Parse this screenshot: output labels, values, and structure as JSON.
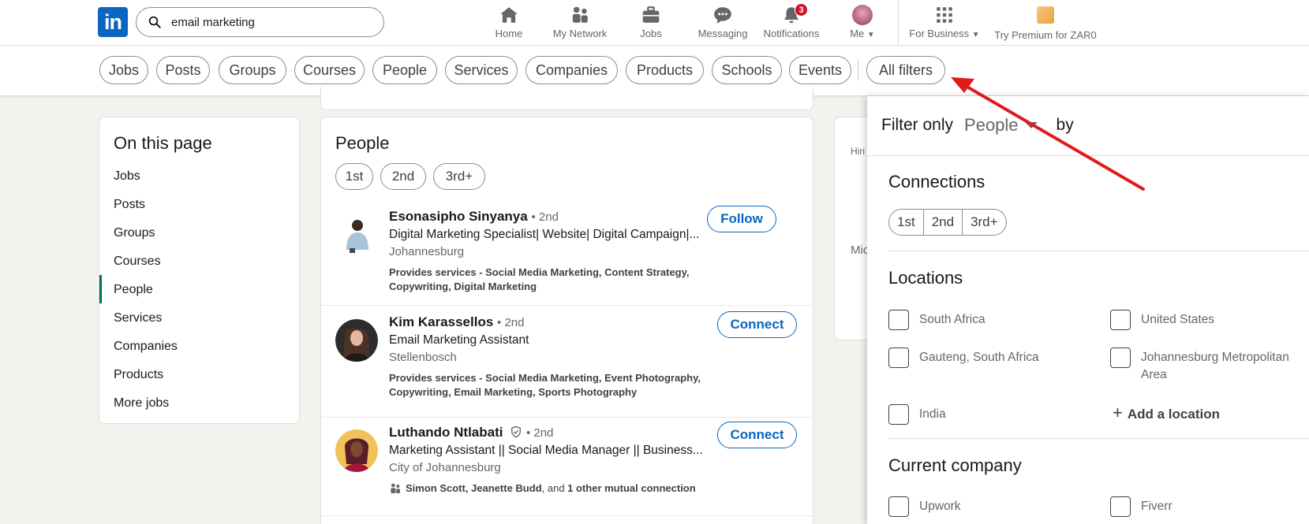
{
  "header": {
    "logo_text": "in",
    "search_value": "email marketing",
    "nav": [
      {
        "label": "Home"
      },
      {
        "label": "My Network"
      },
      {
        "label": "Jobs"
      },
      {
        "label": "Messaging"
      },
      {
        "label": "Notifications",
        "badge": "3"
      },
      {
        "label": "Me"
      },
      {
        "label": "For Business"
      },
      {
        "label": "Try Premium for ZAR0"
      }
    ]
  },
  "filters": {
    "chips": [
      "Jobs",
      "Posts",
      "Groups",
      "Courses",
      "People",
      "Services",
      "Companies",
      "Products",
      "Schools",
      "Events"
    ],
    "all_filters": "All filters"
  },
  "on_this_page": {
    "title": "On this page",
    "items": [
      "Jobs",
      "Posts",
      "Groups",
      "Courses",
      "People",
      "Services",
      "Companies",
      "Products",
      "More jobs"
    ],
    "active_index": 4
  },
  "people": {
    "title": "People",
    "degree_chips": [
      "1st",
      "2nd",
      "3rd+"
    ],
    "results": [
      {
        "name": "Esonasipho Sinyanya",
        "degree": "• 2nd",
        "headline": "Digital Marketing Specialist| Website| Digital Campaign|...",
        "location": "Johannesburg",
        "extra_prefix": "Provides services - ",
        "extra": "Social Media Marketing, Content Strategy, Copywriting, Digital Marketing",
        "action": "Follow"
      },
      {
        "name": "Kim Karassellos",
        "degree": "• 2nd",
        "headline": "Email Marketing Assistant",
        "location": "Stellenbosch",
        "extra_prefix": "Provides services - ",
        "extra": "Social Media Marketing, Event Photography, Copywriting, Email Marketing, Sports Photography",
        "action": "Connect"
      },
      {
        "name": "Luthando Ntlabati",
        "degree": "• 2nd",
        "headline": "Marketing Assistant || Social Media Manager || Business...",
        "location": "City of Johannesburg",
        "mutual_names": "Simon Scott, Jeanette Budd",
        "mutual_and": ", and ",
        "mutual_rest": "1 other mutual connection",
        "action": "Connect"
      }
    ]
  },
  "behind_card": {
    "text_1": "Hiri",
    "text_2": "Mic"
  },
  "panel": {
    "filter_only": "Filter only",
    "selected": "People",
    "by": "by",
    "connections_title": "Connections",
    "connections": [
      "1st",
      "2nd",
      "3rd+"
    ],
    "locations_title": "Locations",
    "locations": [
      "South Africa",
      "United States",
      "Gauteng, South Africa",
      "Johannesburg Metropolitan Area",
      "India"
    ],
    "add_location": "Add a location",
    "company_title": "Current company",
    "companies": [
      "Upwork",
      "Fiverr"
    ]
  },
  "colors": {
    "brand": "#0a66c2",
    "active": "#01754f",
    "badge": "#cb112d",
    "annotation_arrow": "#e01b1b"
  }
}
